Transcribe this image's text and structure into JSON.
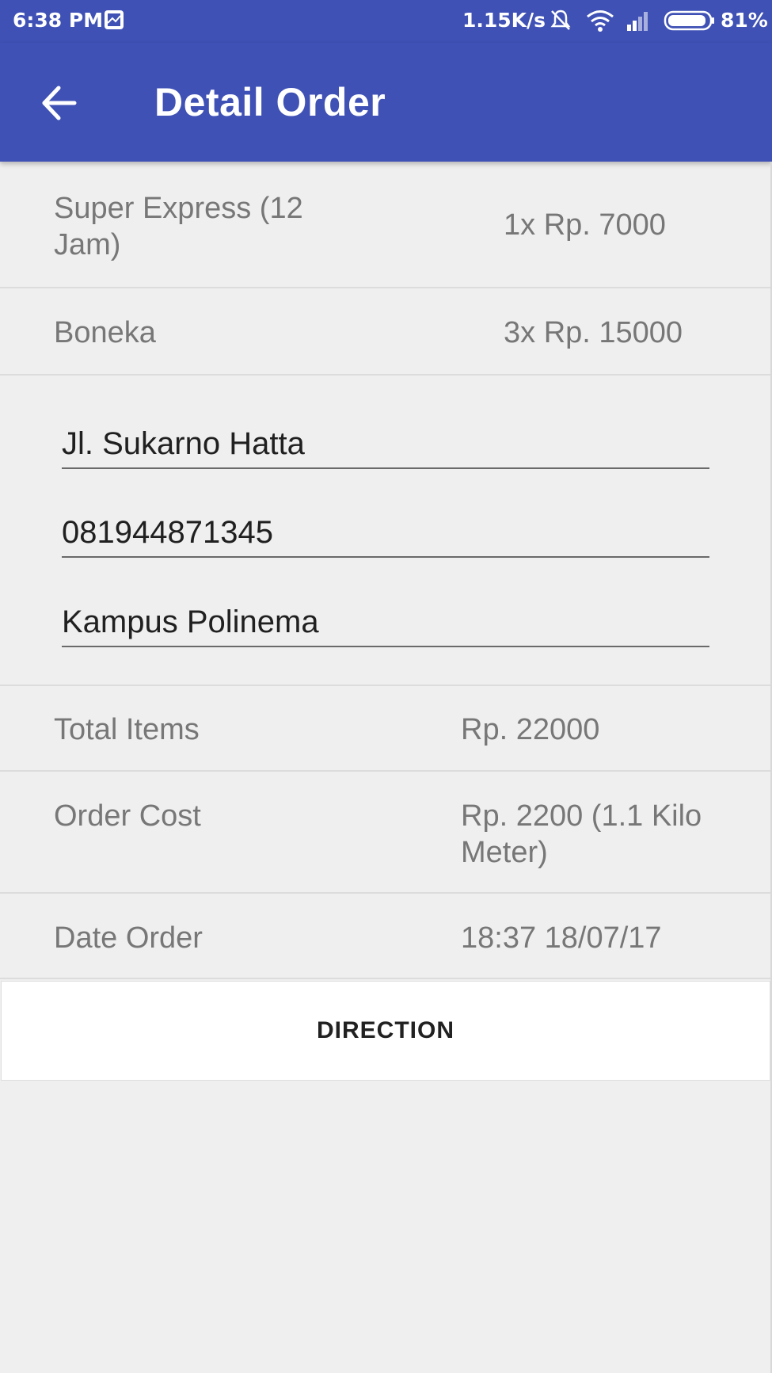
{
  "status_bar": {
    "time": "6:38 PM",
    "net_speed": "1.15K/s",
    "battery_percent": "81%",
    "battery_level": 0.81,
    "icons": [
      "gallery-icon",
      "mute-icon",
      "wifi-icon",
      "signal-icon",
      "battery-icon"
    ]
  },
  "app_bar": {
    "title": "Detail Order",
    "color": "#3f51b5",
    "back_icon": "arrow-back-icon"
  },
  "items": [
    {
      "name": "Super Express (12",
      "name_line2": "Jam)",
      "price": "1x Rp. 7000"
    },
    {
      "name": "Boneka",
      "price": "3x Rp. 15000"
    }
  ],
  "fields": {
    "address": "Jl. Sukarno Hatta",
    "phone": "081944871345",
    "note": "Kampus Polinema"
  },
  "summary": {
    "total_items_label": "Total Items",
    "total_items_value": "Rp. 22000",
    "order_cost_label": "Order Cost",
    "order_cost_value": "Rp. 2200 (1.1 Kilo",
    "order_cost_value_line2": "Meter)",
    "date_order_label": "Date Order",
    "date_order_value": "18:37 18/07/17"
  },
  "direction_button": "DIRECTION"
}
